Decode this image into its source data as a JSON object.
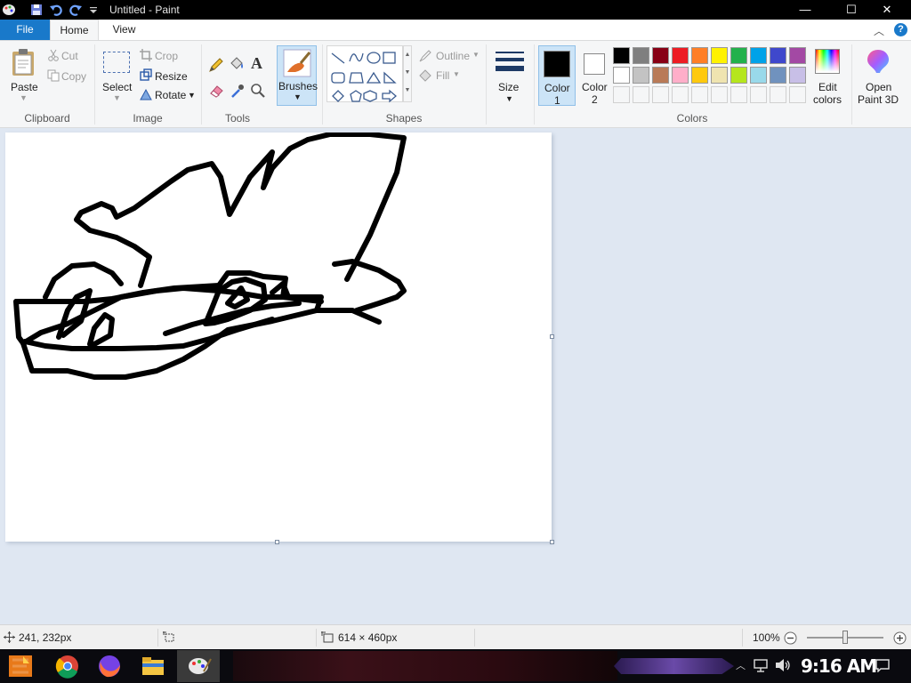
{
  "window": {
    "title": "Untitled - Paint",
    "controls": {
      "minimize": "—",
      "maximize": "☐",
      "close": "✕"
    }
  },
  "tabs": {
    "file": "File",
    "home": "Home",
    "view": "View",
    "help": "?"
  },
  "ribbon": {
    "clipboard": {
      "paste": "Paste",
      "cut": "Cut",
      "copy": "Copy",
      "label": "Clipboard"
    },
    "image": {
      "select": "Select",
      "crop": "Crop",
      "resize": "Resize",
      "rotate": "Rotate",
      "label": "Image"
    },
    "tools": {
      "label": "Tools"
    },
    "brushes": {
      "label": "Brushes"
    },
    "shapes": {
      "outline": "Outline",
      "fill": "Fill",
      "label": "Shapes"
    },
    "size": {
      "label": "Size"
    },
    "color1": {
      "line1": "Color",
      "line2": "1",
      "value": "#000000"
    },
    "color2": {
      "line1": "Color",
      "line2": "2",
      "value": "#ffffff"
    },
    "colors": {
      "label": "Colors",
      "row1": [
        "#000000",
        "#7f7f7f",
        "#880015",
        "#ed1c24",
        "#ff7f27",
        "#fff200",
        "#22b14c",
        "#00a2e8",
        "#3f48cc",
        "#a349a4"
      ],
      "row2": [
        "#ffffff",
        "#c3c3c3",
        "#b97a57",
        "#ffaec9",
        "#ffc90e",
        "#efe4b0",
        "#b5e61d",
        "#99d9ea",
        "#7092be",
        "#c8bfe7"
      ],
      "row3": [
        "#f5f6f7",
        "#f5f6f7",
        "#f5f6f7",
        "#f5f6f7",
        "#f5f6f7",
        "#f5f6f7",
        "#f5f6f7",
        "#f5f6f7",
        "#f5f6f7",
        "#f5f6f7"
      ]
    },
    "edit_colors": {
      "line1": "Edit",
      "line2": "colors"
    },
    "paint3d": {
      "line1": "Open",
      "line2": "Paint 3D"
    }
  },
  "status": {
    "cursor_position": "241, 232px",
    "image_size": "614 × 460px",
    "zoom": "100%",
    "zoom_level": 1.0
  },
  "taskbar": {
    "clock": "9:16 AM"
  }
}
